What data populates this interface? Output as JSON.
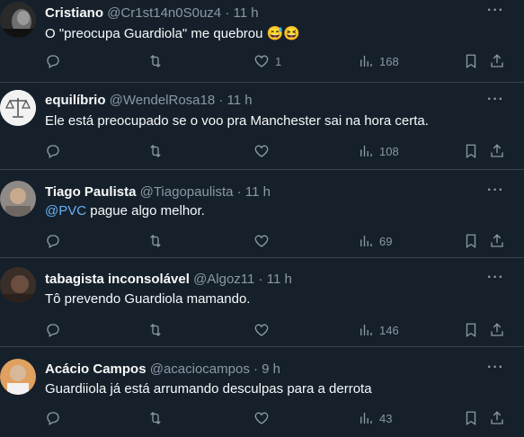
{
  "tweets": [
    {
      "name": "Cristiano",
      "handle": "@Cr1st14n0S0uz4",
      "time": "11 h",
      "text": "O \"preocupa Guardiola\" me quebrou 😅😆",
      "likes": "1",
      "views": "168",
      "avatar": "avatar-dark"
    },
    {
      "name": "equilíbrio",
      "handle": "@WendelRosa18",
      "time": "11 h",
      "text": "Ele está  preocupado se o voo pra Manchester sai na hora certa.",
      "likes": "",
      "views": "108",
      "avatar": "scales-icon"
    },
    {
      "name": "Tiago Paulista",
      "handle": "@Tiagopaulista",
      "time": "11 h",
      "mention": "@PVC",
      "text": " pague algo melhor.",
      "likes": "",
      "views": "69",
      "avatar": "avatar-photo"
    },
    {
      "name": "tabagista inconsolável",
      "handle": "@Algoz11",
      "time": "11 h",
      "text": "Tô prevendo Guardiola mamando.",
      "likes": "",
      "views": "146",
      "avatar": "avatar-photo"
    },
    {
      "name": "Acácio Campos",
      "handle": "@acaciocampos",
      "time": "9 h",
      "text": "Guardiiola já está arrumando desculpas para a derrota",
      "likes": "",
      "views": "43",
      "avatar": "avatar-photo"
    }
  ],
  "separator": " · ",
  "more_label": "···",
  "colors": {
    "background": "#15202b",
    "text": "#f7f9f9",
    "muted": "#8b98a5",
    "link": "#6ab2f2",
    "border": "#38444d"
  },
  "icons": [
    "reply-icon",
    "retweet-icon",
    "like-icon",
    "views-icon",
    "bookmark-icon",
    "share-icon",
    "more-icon"
  ]
}
